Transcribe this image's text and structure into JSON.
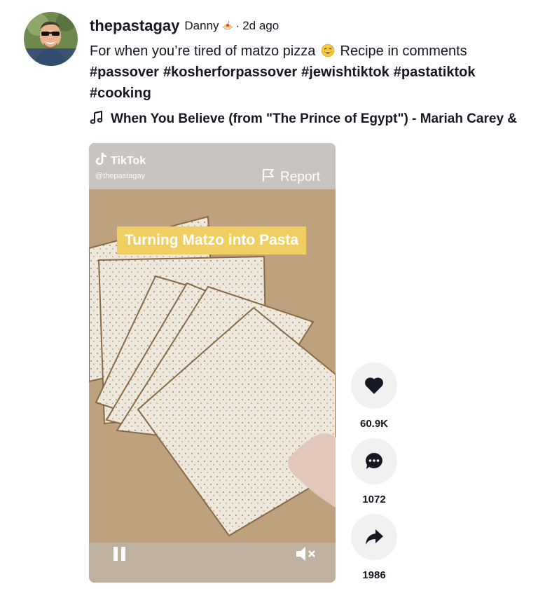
{
  "author": {
    "username": "thepastagay",
    "nickname": "Danny",
    "separator": "·",
    "age": "2d ago"
  },
  "caption": {
    "text": "For when you’re tired of matzo pizza",
    "text_after_emoji": "Recipe in comments",
    "hashtags": [
      "#passover",
      "#kosherforpassover",
      "#jewishtiktok",
      "#pastatiktok",
      "#cooking"
    ]
  },
  "music": {
    "title": "When You Believe (from \"The Prince of Egypt\") - Mariah Carey &",
    "icon": "music-note-icon"
  },
  "video": {
    "watermark_brand": "TikTok",
    "watermark_user": "@thepastagay",
    "report_label": "Report",
    "overlay_text": "Turning Matzo into Pasta",
    "state": "playing",
    "muted": true
  },
  "actions": {
    "likes": "60.9K",
    "comments": "1072",
    "shares": "1986"
  },
  "colors": {
    "text": "#161823",
    "action_bg": "#f1f1f2",
    "overlay_bg": "#f0cf62",
    "video_bg": "#b89c78"
  }
}
